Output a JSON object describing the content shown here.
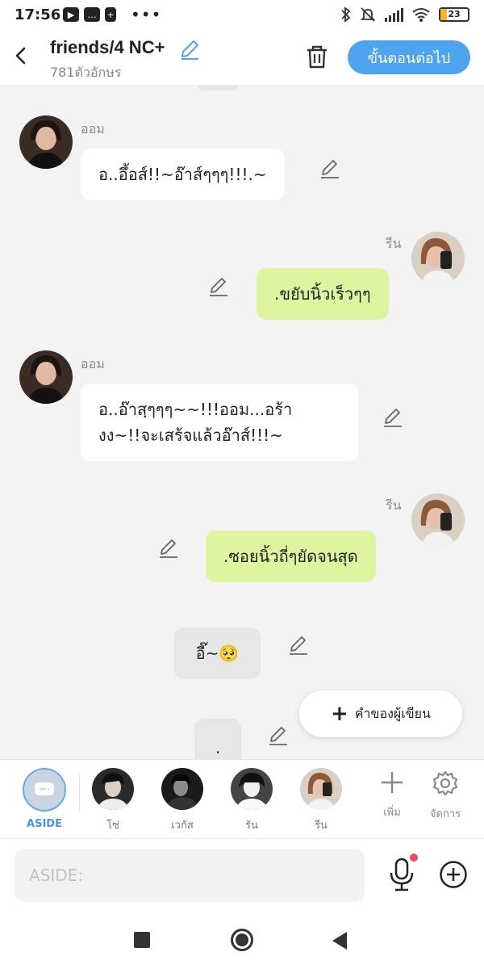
{
  "status_bar": {
    "time": "17:56",
    "battery": "23",
    "battery_level": 0.23,
    "icons": [
      "media-icon",
      "message-icon",
      "battery-saver-icon",
      "more-dots-icon",
      "bluetooth-icon",
      "mute-icon",
      "signal-icon",
      "wifi-icon"
    ]
  },
  "header": {
    "title": "friends/4 NC+",
    "subtitle": "781ตัวอักษร",
    "next_label": "ขั้นตอนต่อไป",
    "accent": "#4fa4ef"
  },
  "messages": [
    {
      "side": "left",
      "sender": "ออม",
      "text": "อ..อึ้อส์!!~อ๊าส์ๆๆๆ!!!.~"
    },
    {
      "side": "right",
      "sender": "รีน",
      "text": ".ขยับนิ้วเร็วๆๆ"
    },
    {
      "side": "left",
      "sender": "ออม",
      "text_lines": [
        "อ..อ๊าสฺๆๆๆ~~!!!ออม...อร้า",
        "งง~!!จะเสร้จแล้วอ๊าส์!!!~"
      ]
    },
    {
      "side": "right",
      "sender": "รีน",
      "text": ".ซอยนิ้วถี่ๆยัดจนสุด"
    },
    {
      "side": "center",
      "text": "อี๊~🥺"
    },
    {
      "side": "center",
      "text": "."
    }
  ],
  "fab": {
    "label": "คำของผู้เขียน"
  },
  "characters": [
    {
      "label": "ASIDE",
      "active": true
    },
    {
      "label": "โซ่"
    },
    {
      "label": "เวกัส"
    },
    {
      "label": "รัน"
    },
    {
      "label": "รีน"
    }
  ],
  "tools": [
    {
      "label": "เพิ่ม"
    },
    {
      "label": "จัดการ"
    }
  ],
  "input": {
    "placeholder": "ASIDE:"
  },
  "colors": {
    "green_bubble": "#dcf59e",
    "white_bubble": "#ffffff",
    "accent": "#4fa4ef"
  }
}
